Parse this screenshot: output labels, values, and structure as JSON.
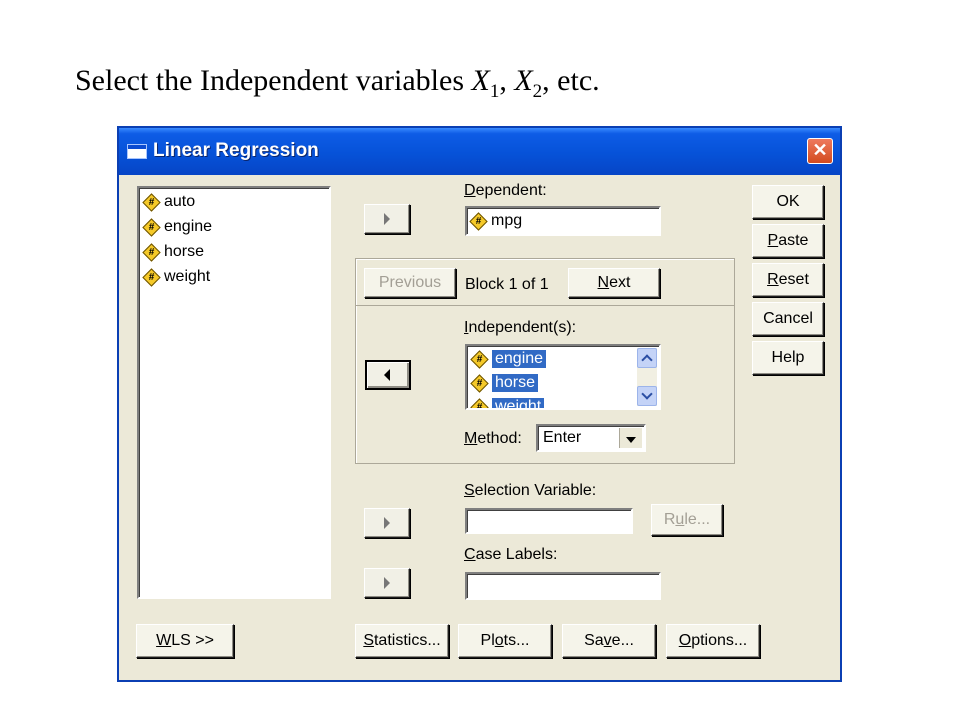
{
  "caption": {
    "prefix": "Select the Independent variables ",
    "var1": "X",
    "sub1": "1",
    "sep": ", ",
    "var2": "X",
    "sub2": "2",
    "suffix": ", etc."
  },
  "window": {
    "title": "Linear Regression",
    "close_glyph": "✕"
  },
  "source_list": {
    "items": [
      {
        "label": "auto",
        "icon": "numeric-variable-icon"
      },
      {
        "label": "engine",
        "icon": "numeric-variable-icon"
      },
      {
        "label": "horse",
        "icon": "numeric-variable-icon"
      },
      {
        "label": "weight",
        "icon": "numeric-variable-icon"
      }
    ]
  },
  "variable_icon_glyph": "#",
  "dependent": {
    "label_u": "D",
    "label_rest": "ependent:",
    "value": "mpg"
  },
  "block": {
    "previous_label": "Previous",
    "status": "Block 1 of 1",
    "next_label_u": "N",
    "next_label_rest": "ext"
  },
  "independents": {
    "label_u": "I",
    "label_rest": "ndependent(s):",
    "items": [
      {
        "label": "engine"
      },
      {
        "label": "horse"
      },
      {
        "label": "weight"
      }
    ]
  },
  "method": {
    "label_u": "M",
    "label_rest": "ethod:",
    "value": "Enter"
  },
  "selection_variable": {
    "label_u": "S",
    "label_rest": "election Variable:",
    "value": "",
    "rule_label_u": "u",
    "rule_label_pre": "R",
    "rule_label_rest": "le..."
  },
  "case_labels": {
    "label_u": "C",
    "label_rest": "ase Labels:",
    "value": ""
  },
  "side_buttons": {
    "ok": "OK",
    "paste_u": "P",
    "paste_rest": "aste",
    "reset_u": "R",
    "reset_rest": "eset",
    "cancel": "Cancel",
    "help": "Help"
  },
  "bottom_buttons": {
    "wls_u": "W",
    "wls_rest": "LS >>",
    "statistics_u": "S",
    "statistics_rest": "tatistics...",
    "plots_pre": "Pl",
    "plots_u": "o",
    "plots_rest": "ts...",
    "save_pre": "Sa",
    "save_u": "v",
    "save_rest": "e...",
    "options_u": "O",
    "options_rest": "ptions..."
  }
}
